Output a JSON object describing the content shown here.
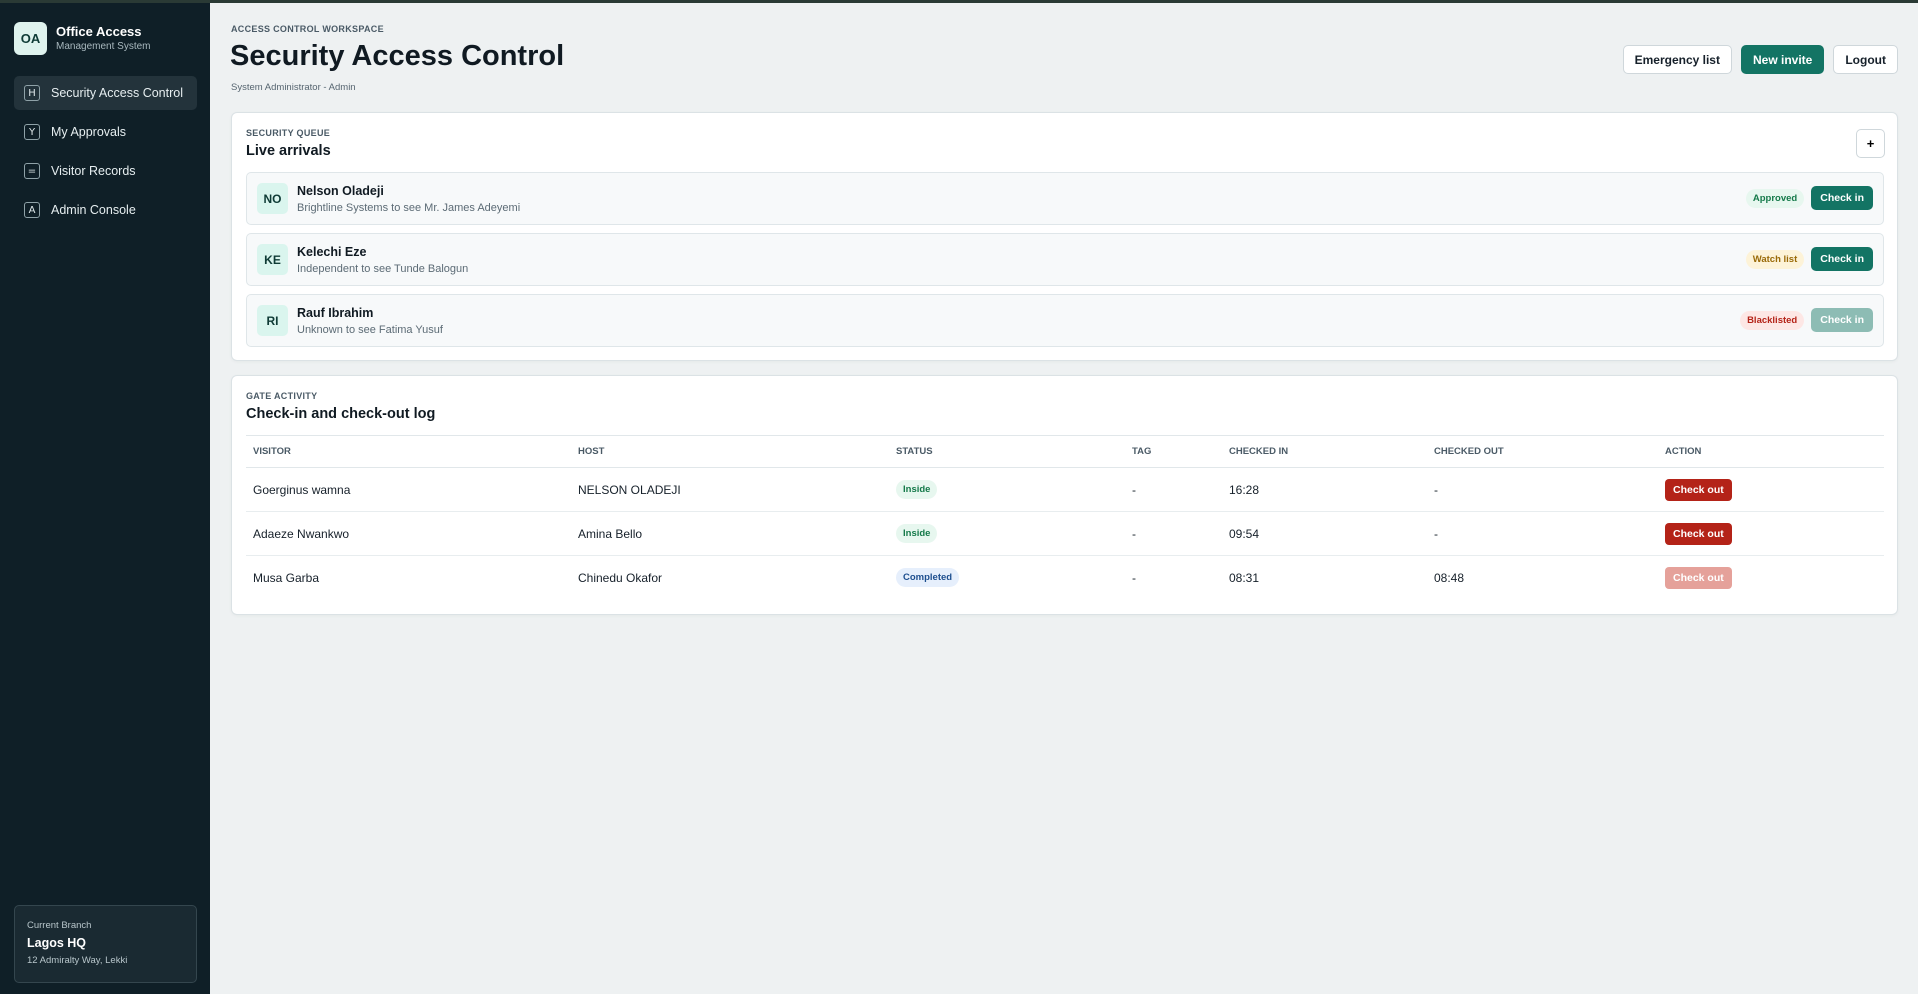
{
  "brand": {
    "logo": "OA",
    "name": "Office Access",
    "subtitle": "Management System"
  },
  "sidebar": {
    "items": [
      {
        "key": "H",
        "label": "Security Access Control",
        "active": true
      },
      {
        "key": "Y",
        "label": "My Approvals"
      },
      {
        "key": "=",
        "label": "Visitor Records"
      },
      {
        "key": "A",
        "label": "Admin Console"
      }
    ],
    "branch": {
      "caption": "Current Branch",
      "name": "Lagos HQ",
      "address": "12 Admiralty Way, Lekki"
    }
  },
  "header": {
    "eyebrow": "ACCESS CONTROL WORKSPACE",
    "title": "Security Access Control",
    "subtitle": "System Administrator - Admin",
    "actions": {
      "emergency": "Emergency list",
      "new_invite": "New invite",
      "logout": "Logout"
    }
  },
  "queue": {
    "eyebrow": "SECURITY QUEUE",
    "title": "Live arrivals",
    "add_label": "+",
    "arrivals": [
      {
        "initials": "NO",
        "name": "Nelson Oladeji",
        "desc": "Brightline Systems to see Mr. James Adeyemi",
        "status": "Approved",
        "action": "Check in"
      },
      {
        "initials": "KE",
        "name": "Kelechi Eze",
        "desc": "Independent to see Tunde Balogun",
        "status": "Watch list",
        "action": "Check in"
      },
      {
        "initials": "RI",
        "name": "Rauf Ibrahim",
        "desc": "Unknown to see Fatima Yusuf",
        "status": "Blacklisted",
        "action": "Check in"
      }
    ]
  },
  "log": {
    "eyebrow": "GATE ACTIVITY",
    "title": "Check-in and check-out log",
    "columns": [
      "VISITOR",
      "HOST",
      "STATUS",
      "TAG",
      "CHECKED IN",
      "CHECKED OUT",
      "ACTION"
    ],
    "rows": [
      {
        "visitor": "Goerginus wamna",
        "host": "NELSON OLADEJI",
        "status": "Inside",
        "tag": "-",
        "checked_in": "16:28",
        "checked_out": "-",
        "action": "Check out"
      },
      {
        "visitor": "Adaeze Nwankwo",
        "host": "Amina Bello",
        "status": "Inside",
        "tag": "-",
        "checked_in": "09:54",
        "checked_out": "-",
        "action": "Check out"
      },
      {
        "visitor": "Musa Garba",
        "host": "Chinedu Okafor",
        "status": "Completed",
        "tag": "-",
        "checked_in": "08:31",
        "checked_out": "08:48",
        "action": "Check out"
      }
    ]
  },
  "colors": {
    "sidebar_bg": "#0f1f27",
    "primary": "#137464",
    "danger": "#b42318"
  }
}
